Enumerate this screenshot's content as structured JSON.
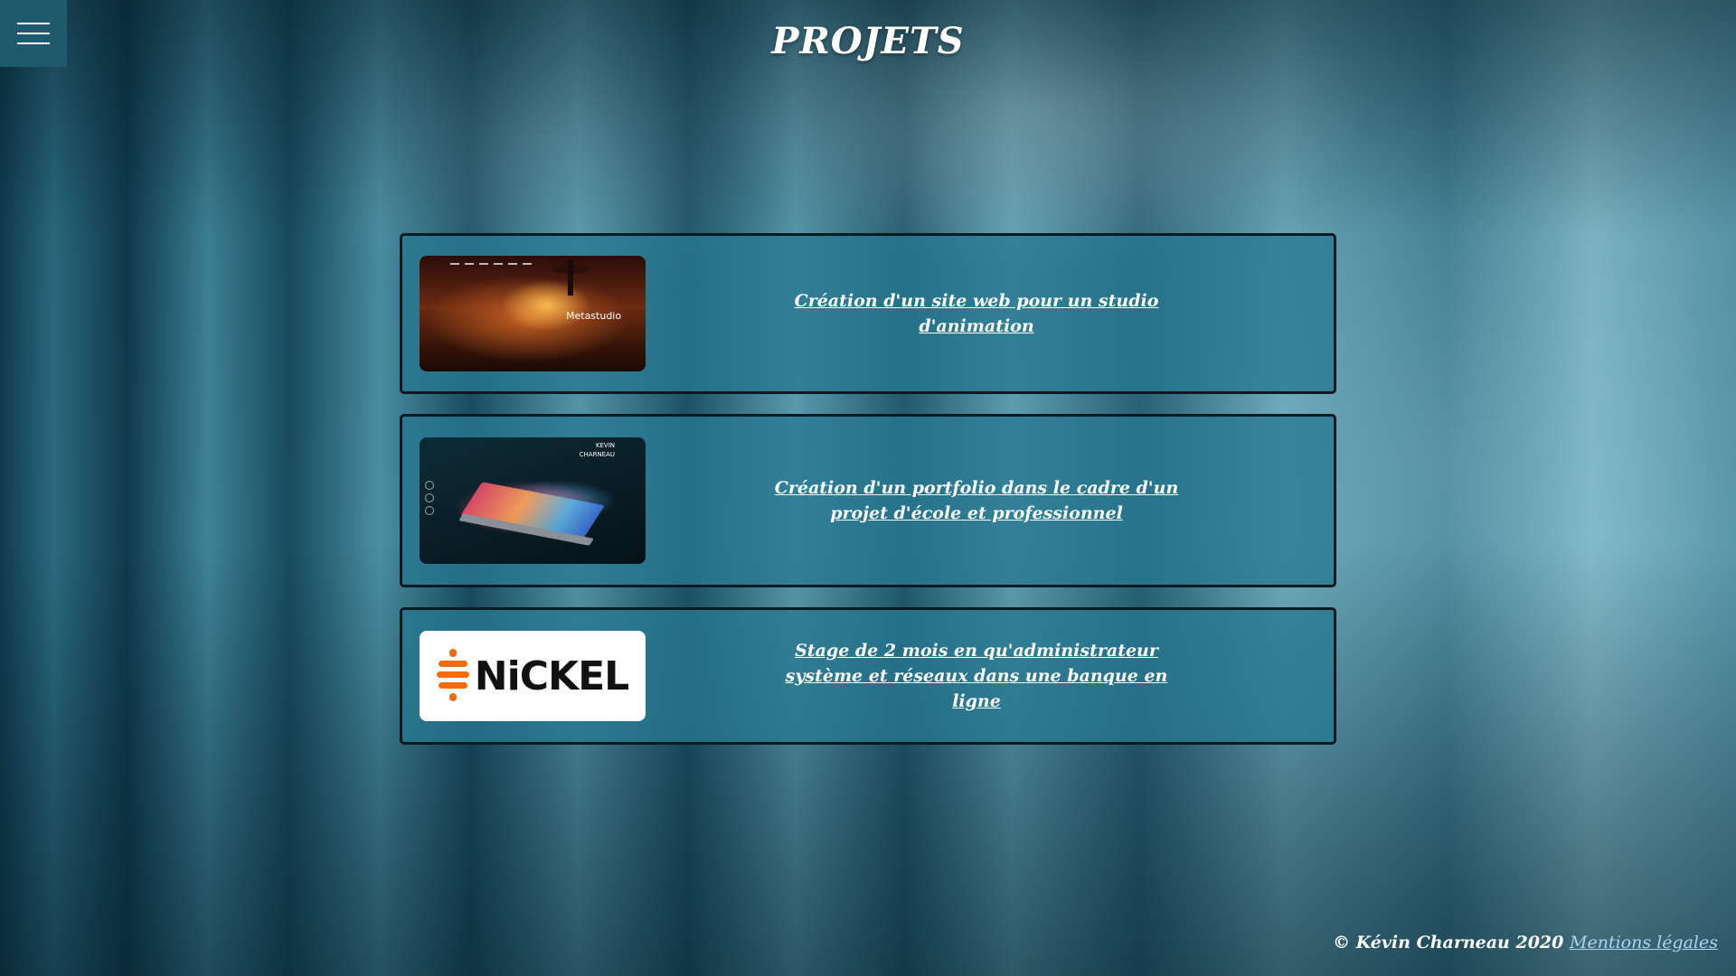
{
  "page": {
    "title": "PROJETS"
  },
  "menu": {
    "icon": "hamburger-menu-icon"
  },
  "projects": [
    {
      "image_alt": "Metastudio website preview",
      "thumb_label": "Metastudio",
      "link_text": "Création d'un site web pour un studio d'animation"
    },
    {
      "image_alt": "Portfolio website preview",
      "thumb_label": "KEVIN\nCHARNEAU",
      "link_text": "Création d'un portfolio dans le cadre d'un projet d'école et professionnel"
    },
    {
      "image_alt": "Nickel logo",
      "thumb_label": "NiCKEL",
      "link_text": "Stage de 2 mois en qu'administrateur système et réseaux dans une banque en ligne"
    }
  ],
  "footer": {
    "copyright": "© Kévin Charneau 2020",
    "legal_link": "Mentions légales"
  },
  "colors": {
    "card_background": "#26788f",
    "card_border": "#0a1a20",
    "link": "#a9d4f2",
    "nickel_orange": "#f26b0f"
  }
}
